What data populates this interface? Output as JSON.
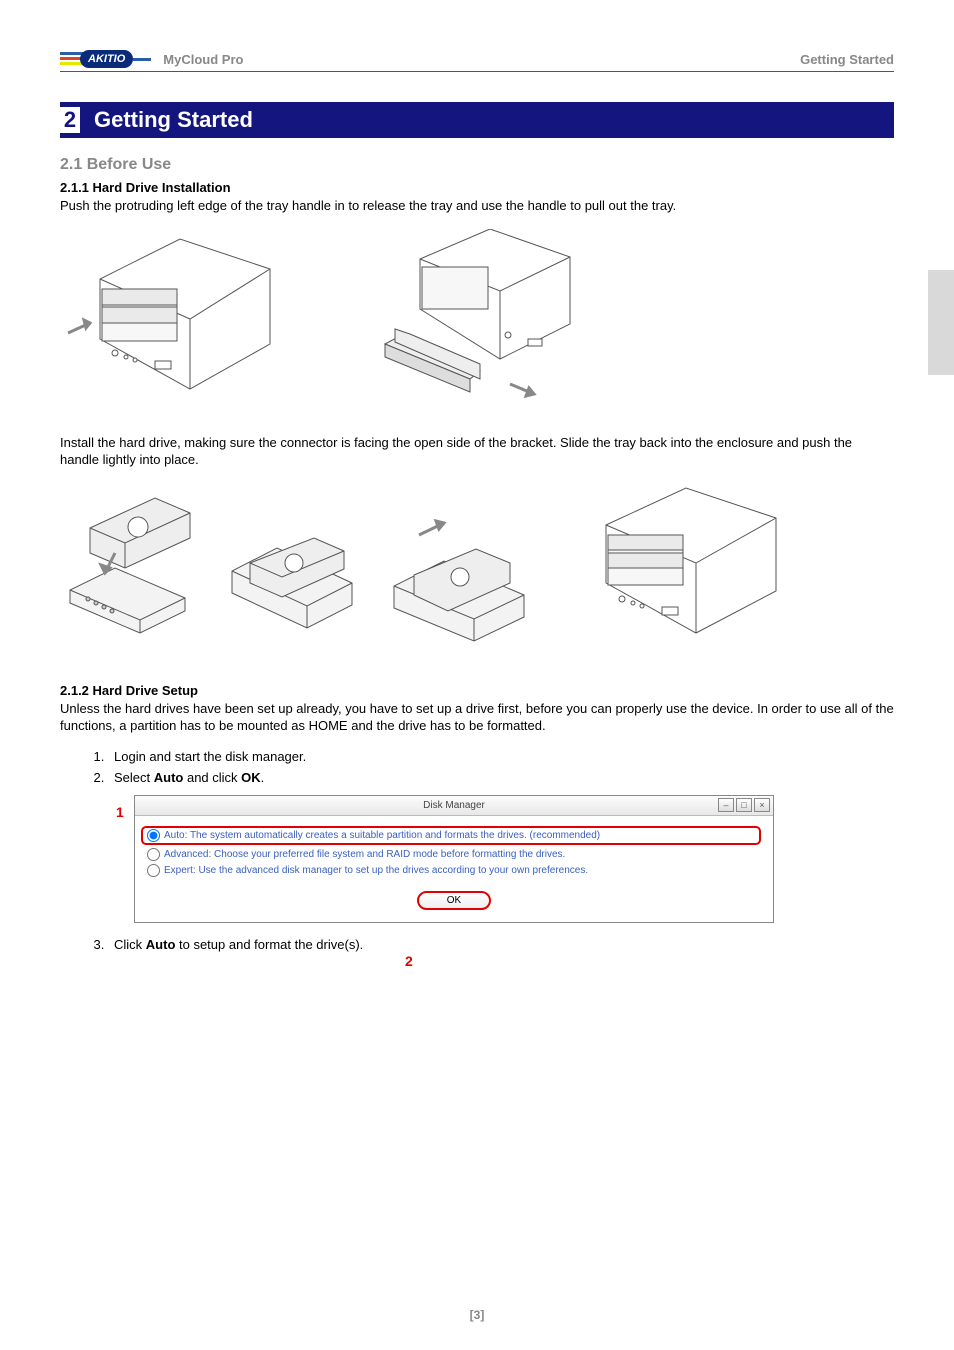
{
  "header": {
    "logo_text": "AKITIO",
    "product": "MyCloud Pro",
    "section": "Getting Started"
  },
  "chapter": {
    "number": "2",
    "title": "Getting Started"
  },
  "section_2_1": {
    "number_title": "2.1   Before Use",
    "sub_2_1_1": {
      "heading": "2.1.1   Hard Drive Installation",
      "para1": "Push the protruding left edge of the tray handle in to release the tray and use the handle to pull out the tray.",
      "para2": "Install the hard drive, making sure the connector is facing the open side of the bracket. Slide the tray back into the enclosure and push the handle lightly into place."
    },
    "sub_2_1_2": {
      "heading": "2.1.2   Hard Drive Setup",
      "para": "Unless the hard drives have been set up already, you have to set up a drive first, before you can properly use the device. In order to use all of the functions, a partition has to be mounted as HOME and the drive has to be formatted.",
      "steps": [
        "Login and start the disk manager.",
        "Select Auto and click OK.",
        "Click Auto to setup and format the drive(s)."
      ],
      "step2_bold": [
        "Auto",
        "OK"
      ],
      "step3_bold": [
        "Auto"
      ]
    }
  },
  "dialog": {
    "title": "Disk Manager",
    "options": [
      "Auto: The system automatically creates a suitable partition and formats the drives. (recommended)",
      "Advanced: Choose your preferred file system and RAID mode before formatting the drives.",
      "Expert: Use the advanced disk manager to set up the drives according to your own preferences."
    ],
    "ok": "OK",
    "callouts": {
      "one": "1",
      "two": "2"
    },
    "window_buttons": {
      "min": "–",
      "max": "□",
      "close": "×"
    }
  },
  "page_number": "[3]"
}
